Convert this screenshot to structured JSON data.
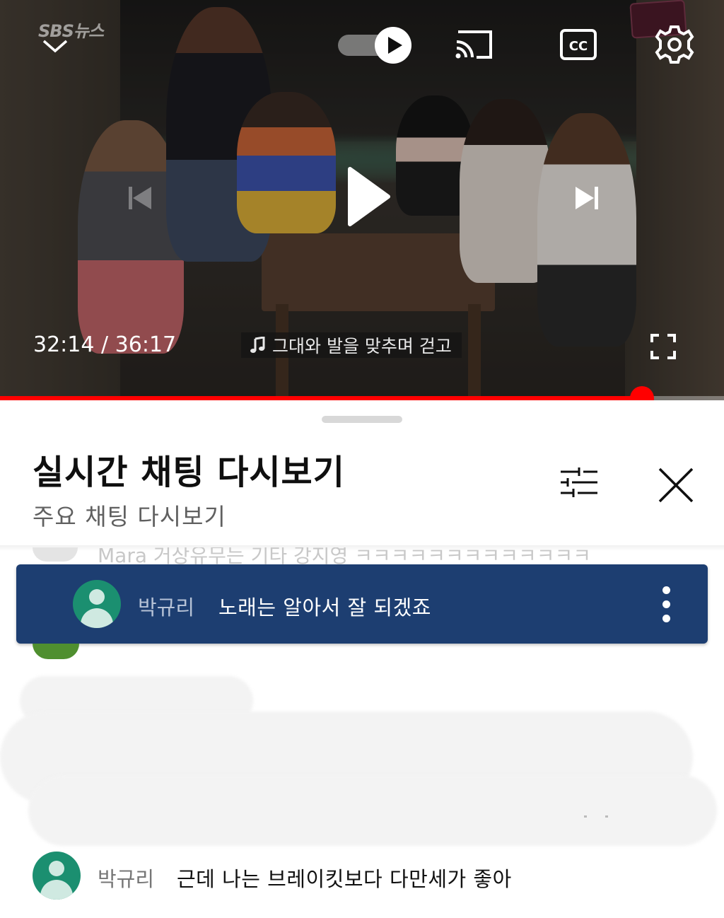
{
  "player": {
    "channel_logo": "SBS뉴스",
    "time_current": "32:14",
    "time_separator": " / ",
    "time_total": "36:17",
    "progress_fraction": 0.887,
    "music_title": "그대와 발을 맞추며 걷고",
    "icons": {
      "collapse": "chevron-down-icon",
      "autoplay": "autoplay-toggle-icon",
      "cast": "cast-icon",
      "captions": "cc-icon",
      "settings": "gear-icon",
      "previous": "skip-previous-icon",
      "play": "play-icon",
      "next": "skip-next-icon",
      "music": "music-note-icon",
      "fullscreen": "fullscreen-icon"
    },
    "accent_color": "#ff0000"
  },
  "sheet": {
    "title": "실시간 채팅 다시보기",
    "subtitle": "주요 채팅 다시보기",
    "icons": {
      "filter": "sliders-icon",
      "close": "close-icon"
    },
    "ghost_text": "Mara  거상유무는 기타 강지영 ㅋㅋㅋㅋㅋㅋㅋㅋㅋㅋㅋㅋㅋ"
  },
  "pinned_message": {
    "author": "박규리",
    "text": "노래는 알아서 잘 되겠죠",
    "background": "#1d3e71",
    "icons": {
      "avatar": "default-avatar-icon",
      "more": "more-vertical-icon"
    }
  },
  "chat_messages": [
    {
      "author": "박규리",
      "text": "근데 나는 브레이킷보다 다만세가 좋아"
    }
  ]
}
